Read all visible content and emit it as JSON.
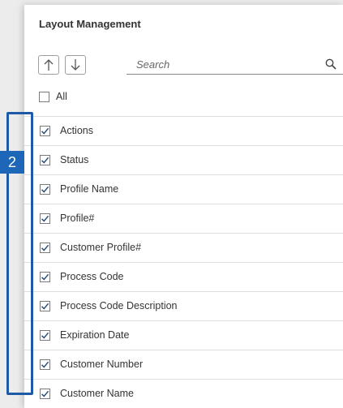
{
  "panel": {
    "title": "Layout Management",
    "search_placeholder": "Search",
    "all_label": "All"
  },
  "icons": {
    "sort_up": "arrow-up-icon",
    "sort_down": "arrow-down-icon",
    "search": "search-icon",
    "check": "check-icon"
  },
  "columns": [
    {
      "label": "Actions",
      "checked": true
    },
    {
      "label": "Status",
      "checked": true
    },
    {
      "label": "Profile Name",
      "checked": true
    },
    {
      "label": "Profile#",
      "checked": true
    },
    {
      "label": "Customer Profile#",
      "checked": true
    },
    {
      "label": "Process Code",
      "checked": true
    },
    {
      "label": "Process Code Description",
      "checked": true
    },
    {
      "label": "Expiration Date",
      "checked": true
    },
    {
      "label": "Customer Number",
      "checked": true
    },
    {
      "label": "Customer Name",
      "checked": true
    }
  ],
  "annotation": {
    "step_number": "2",
    "color": "#1e66b8"
  }
}
